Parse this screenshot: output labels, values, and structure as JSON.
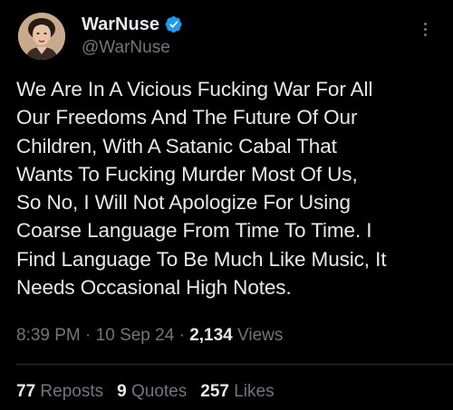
{
  "author": {
    "display_name": "WarNuse",
    "handle": "@WarNuse",
    "verified": true,
    "avatar_icon": "profile-photo"
  },
  "tweet": {
    "text": "We Are In A Vicious Fucking War For All\nOur Freedoms And The Future Of Our\nChildren, With A Satanic Cabal That\nWants To Fucking Murder Most Of Us,\nSo No, I Will Not Apologize For Using\nCoarse Language From Time To Time. I\nFind Language To Be Much Like Music, It\nNeeds Occasional High Notes."
  },
  "meta": {
    "time": "8:39 PM",
    "separator": " · ",
    "date": "10 Sep 24",
    "views_count": "2,134",
    "views_label": " Views"
  },
  "stats": {
    "reposts_count": "77",
    "reposts_label": "Reposts",
    "quotes_count": "9",
    "quotes_label": "Quotes",
    "likes_count": "257",
    "likes_label": "Likes"
  },
  "colors": {
    "background": "#000000",
    "text_primary": "#e7e9ea",
    "text_secondary": "#71767b",
    "verified_badge": "#1d9bf0",
    "divider": "#2f3336"
  }
}
